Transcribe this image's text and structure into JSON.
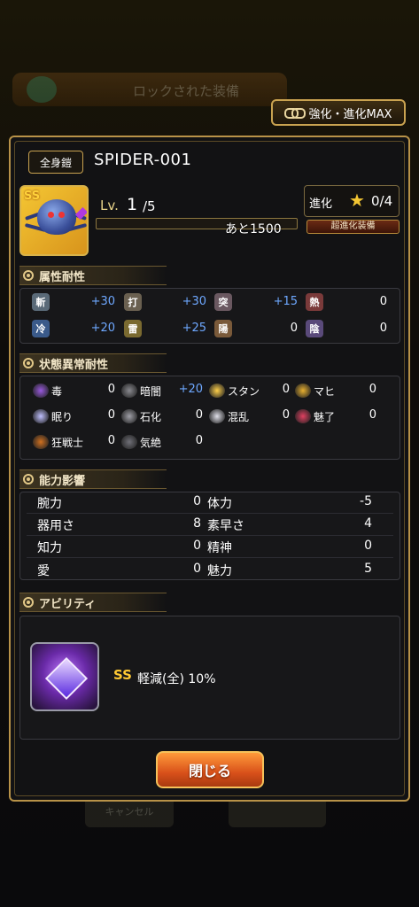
{
  "background": {
    "banner_text": "ロックされた装備",
    "bottom_left": "キャンセル"
  },
  "top_button": {
    "label": "強化・進化MAX"
  },
  "equipment": {
    "type": "全身鎧",
    "name": "SPIDER-001",
    "rank": "SS",
    "level_label": "Lv.",
    "level": "1",
    "level_max": "/5",
    "exp_remaining": "あと1500",
    "exp_progress": 0.0
  },
  "evolution": {
    "label": "進化",
    "value": "0/4",
    "super_tag": "超進化装備"
  },
  "attribute_resist": {
    "title": "属性耐性",
    "rows": [
      [
        {
          "icon": "斬",
          "value": "+30"
        },
        {
          "icon": "打",
          "value": "+30"
        },
        {
          "icon": "突",
          "value": "+15"
        },
        {
          "icon": "熱",
          "value": "0"
        }
      ],
      [
        {
          "icon": "冷",
          "value": "+20"
        },
        {
          "icon": "雷",
          "value": "+25"
        },
        {
          "icon": "陽",
          "value": "0"
        },
        {
          "icon": "陰",
          "value": "0"
        }
      ]
    ]
  },
  "status_resist": {
    "title": "状態異常耐性",
    "rows": [
      [
        {
          "label": "毒",
          "value": "0"
        },
        {
          "label": "暗闇",
          "value": "+20"
        },
        {
          "label": "スタン",
          "value": "0"
        },
        {
          "label": "マヒ",
          "value": "0"
        }
      ],
      [
        {
          "label": "眠り",
          "value": "0"
        },
        {
          "label": "石化",
          "value": "0"
        },
        {
          "label": "混乱",
          "value": "0"
        },
        {
          "label": "魅了",
          "value": "0"
        }
      ],
      [
        {
          "label": "狂戦士",
          "value": "0"
        },
        {
          "label": "気絶",
          "value": "0"
        }
      ]
    ]
  },
  "ability_effect": {
    "title": "能力影響",
    "rows": [
      [
        {
          "label": "腕力",
          "value": "0"
        },
        {
          "label": "体力",
          "value": "-5"
        }
      ],
      [
        {
          "label": "器用さ",
          "value": "8"
        },
        {
          "label": "素早さ",
          "value": "4"
        }
      ],
      [
        {
          "label": "知力",
          "value": "0"
        },
        {
          "label": "精神",
          "value": "0"
        }
      ],
      [
        {
          "label": "愛",
          "value": "0"
        },
        {
          "label": "魅力",
          "value": "5"
        }
      ]
    ]
  },
  "ability": {
    "title": "アビリティ",
    "rank": "SS",
    "text": "軽減(全) 10%"
  },
  "close_button": {
    "label": "閉じる"
  }
}
